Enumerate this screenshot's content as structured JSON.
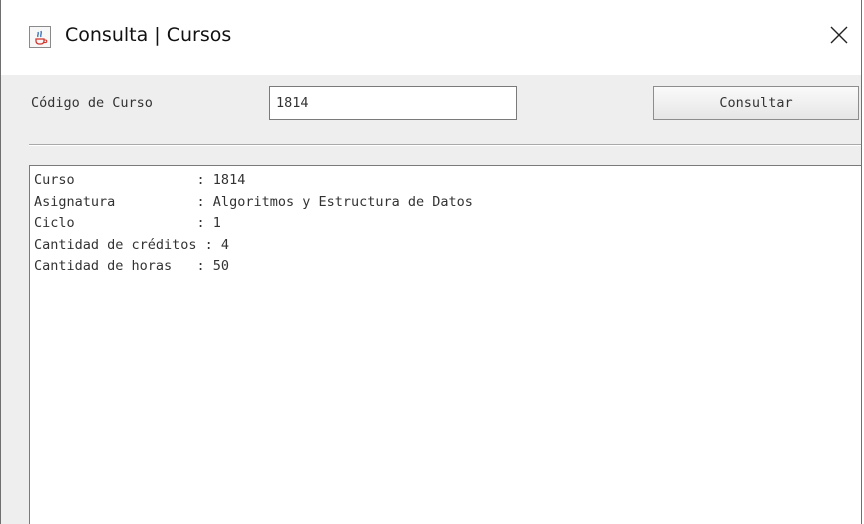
{
  "window": {
    "title": "Consulta | Cursos",
    "app_icon": "java-cup-icon",
    "close_icon": "close-icon"
  },
  "form": {
    "code_label": "Código de Curso",
    "code_value": "1814",
    "consult_button": "Consultar"
  },
  "results": {
    "lines": [
      "Curso               : 1814",
      "Asignatura          : Algoritmos y Estructura de Datos",
      "Ciclo               : 1",
      "Cantidad de créditos : 4",
      "Cantidad de horas   : 50"
    ]
  }
}
